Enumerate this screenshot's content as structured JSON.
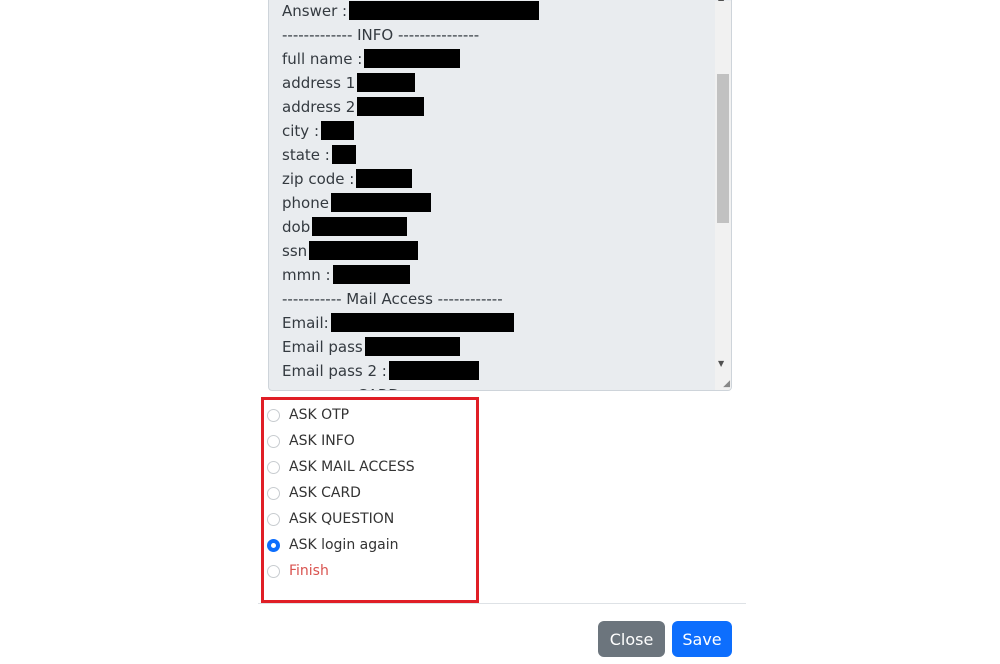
{
  "textarea": {
    "lines": [
      {
        "label": "Answer :",
        "redacted": 1
      },
      {
        "label": "------------- INFO ---------------",
        "redacted": 0
      },
      {
        "label": "full name :",
        "redacted": 1
      },
      {
        "label": "address 1",
        "redacted": 1
      },
      {
        "label": "address 2",
        "redacted": 1
      },
      {
        "label": "city :",
        "redacted": 1
      },
      {
        "label": "state :",
        "redacted": 1
      },
      {
        "label": "zip code :",
        "redacted": 1
      },
      {
        "label": "phone",
        "redacted": 1
      },
      {
        "label": "dob",
        "redacted": 1
      },
      {
        "label": "ssn",
        "redacted": 1
      },
      {
        "label": "mmn :",
        "redacted": 1
      },
      {
        "label": "----------- Mail Access ------------",
        "redacted": 0
      },
      {
        "label": "Email:",
        "redacted": 1
      },
      {
        "label": "Email pass",
        "redacted": 1
      },
      {
        "label": "Email pass 2 :",
        "redacted": 1
      },
      {
        "label": "------------- CARD",
        "redacted": 0
      }
    ]
  },
  "options": [
    {
      "label": "ASK OTP",
      "checked": false
    },
    {
      "label": "ASK INFO",
      "checked": false
    },
    {
      "label": "ASK MAIL ACCESS",
      "checked": false
    },
    {
      "label": "ASK CARD",
      "checked": false
    },
    {
      "label": "ASK QUESTION",
      "checked": false
    },
    {
      "label": "ASK login again",
      "checked": true
    },
    {
      "label": "Finish",
      "checked": false
    }
  ],
  "footer": {
    "close_label": "Close",
    "save_label": "Save"
  },
  "colors": {
    "primary": "#0d6efd",
    "secondary": "#6c757d",
    "highlight_box": "#e01e26",
    "finish_text": "#d9534f"
  }
}
